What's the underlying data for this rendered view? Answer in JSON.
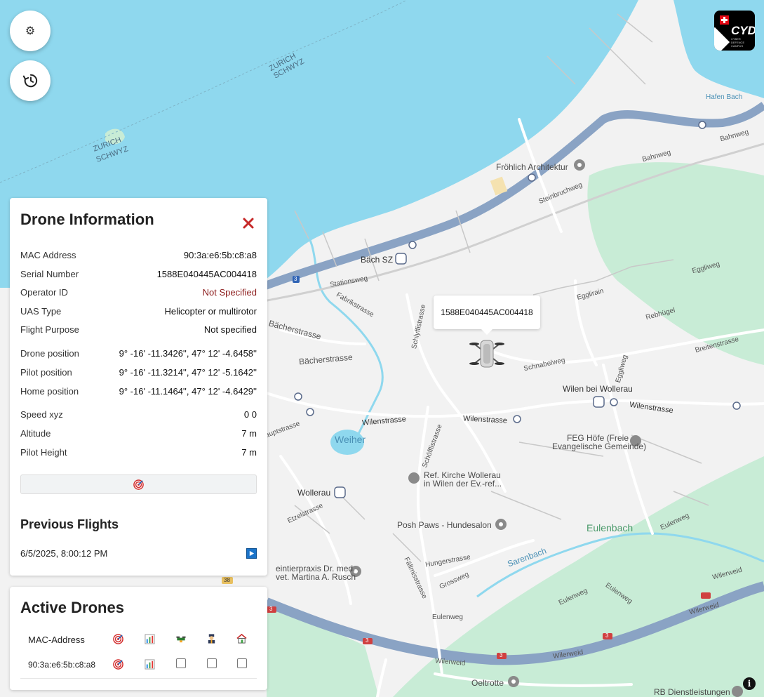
{
  "map": {
    "labels": {
      "border_1a": "ZURICH",
      "border_1b": "SCHWYZ",
      "border_2a": "ZURICH",
      "border_2b": "SCHWYZ",
      "hafen": "Hafen Bach",
      "bahnweg_1": "Bahnweg",
      "bahnweg_2": "Bahnweg",
      "froehlich": "Fröhlich Architektur",
      "steinbruch": "Steinbruchweg",
      "bach_sz": "Bäch SZ",
      "eggliweg": "Eggliweg",
      "stationsweg": "Stationsweg",
      "fabrikstrasse": "Fabrikstrasse",
      "egglirain": "Egglirain",
      "rebhuegel": "Rebhügel",
      "schlyff": "Schlyffistrasse",
      "baecher_1": "Bächerstrasse",
      "baecher_2": "Bächerstrasse",
      "breiten": "Breitenstrasse",
      "schnabelweg": "Schnabelweg",
      "eggliweg_2": "Eggliweg",
      "wilen": "Wilen bei Wollerau",
      "wilenstr_1": "Wilenstrasse",
      "wilenstr_2": "Wilenstrasse",
      "wilenstr_3": "Wilenstrasse",
      "hauptstr": "Hauptstrasse",
      "schoeffli": "Schöfflistrasse",
      "weiher": "Weiher",
      "feg_1": "FEG Höfe (Freie",
      "feg_2": "Evangelische Gemeinde)",
      "ref_1": "Ref. Kirche Wollerau",
      "ref_2": "in Wilen der Ev.-ref...",
      "wollerau": "Wollerau",
      "etzel": "Etzelstrasse",
      "posh": "Posh Paws - Hundesalon",
      "eulenbach": "Eulenbach",
      "eulenweg_1": "Eulenweg",
      "sarenbach": "Sarenbach",
      "praxis_1": "eintierpraxis Dr. med.",
      "praxis_2": "vet. Martina A. Rusch",
      "hunger": "Hungerstrasse",
      "falli": "Fällmisstrasse",
      "grossweg": "Grossweg",
      "eulenweg_2": "Eulenweg",
      "eulenweg_3": "Eulenweg",
      "eulenweg_4": "Eulenweg",
      "wilerweid_1": "Wilerweid",
      "wilerweid_2": "Wilerweid",
      "wilerweid_3": "Wilerweid",
      "wilerweid_4": "Wilerweid",
      "oeltrotte": "Oeltrotte",
      "rb": "RB Dienstleistungen",
      "highway_1": "3",
      "highway_2": "3",
      "highway_3": "3",
      "highway_4": "3",
      "highway_5": "3",
      "highway_6": "38"
    },
    "colors": {
      "water": "#8fd8ee",
      "land": "#f2f2f2",
      "park": "#c8ecd6",
      "highway": "#8aa3c4",
      "road": "#ffffff"
    }
  },
  "marker": {
    "tooltip": "1588E040445AC004418"
  },
  "logo": {
    "text": "CYD",
    "sub": "CYBER DEFENCE CAMPUS"
  },
  "drone_info": {
    "title": "Drone Information",
    "rows": [
      {
        "label": "MAC Address",
        "value": "90:3a:e6:5b:c8:a8"
      },
      {
        "label": "Serial Number",
        "value": "1588E040445AC004418"
      },
      {
        "label": "Operator ID",
        "value": "Not Specified"
      },
      {
        "label": "UAS Type",
        "value": "Helicopter or multirotor"
      },
      {
        "label": "Flight Purpose",
        "value": "Not specified"
      },
      {
        "label": "Drone position",
        "value": "9° -16' -11.3426'', 47° 12' -4.6458''"
      },
      {
        "label": "Pilot position",
        "value": "9° -16' -11.3214'', 47° 12' -5.1642''"
      },
      {
        "label": "Home position",
        "value": "9° -16' -11.1464'', 47° 12' -4.6429''"
      },
      {
        "label": "Speed xyz",
        "value": "0 0"
      },
      {
        "label": "Altitude",
        "value": "7 m"
      },
      {
        "label": "Pilot Height",
        "value": "7 m"
      }
    ],
    "previous_title": "Previous Flights",
    "flights": [
      {
        "date": "6/5/2025, 8:00:12 PM"
      }
    ]
  },
  "active_drones": {
    "title": "Active Drones",
    "header": {
      "mac": "MAC-Address"
    },
    "rows": [
      {
        "mac": "90:3a:e6:5b:c8:a8"
      }
    ]
  },
  "info_button": "i"
}
